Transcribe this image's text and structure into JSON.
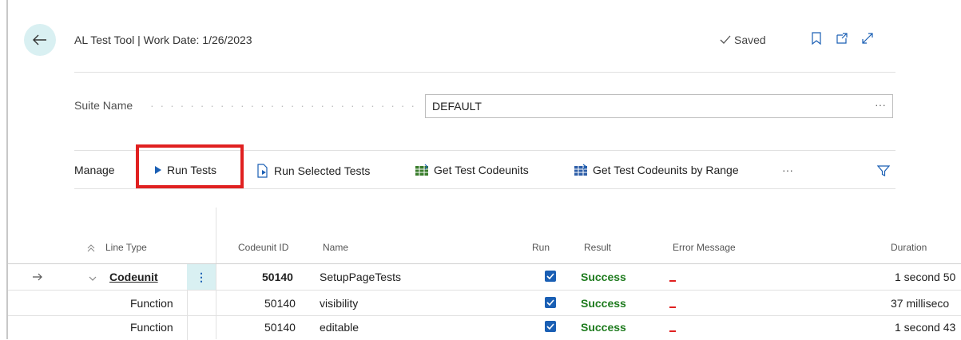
{
  "header": {
    "title": "AL Test Tool | Work Date: 1/26/2023",
    "saved_label": "Saved",
    "icons": [
      "bookmark-icon",
      "open-new-window-icon",
      "expand-icon"
    ]
  },
  "suite": {
    "label": "Suite Name",
    "value": "DEFAULT",
    "ellipsis": "···"
  },
  "actions": {
    "manage": "Manage",
    "run_tests": "Run Tests",
    "run_selected": "Run Selected Tests",
    "get_codeunits": "Get Test Codeunits",
    "get_by_range": "Get Test Codeunits by Range",
    "more": "···"
  },
  "table": {
    "columns": {
      "line_type": "Line Type",
      "codeunit_id": "Codeunit ID",
      "name": "Name",
      "run": "Run",
      "result": "Result",
      "error": "Error Message",
      "duration": "Duration"
    },
    "rows": [
      {
        "line_type": "Codeunit",
        "codeunit_id": "50140",
        "name": "SetupPageTests",
        "run": true,
        "result": "Success",
        "duration": "1 second 50"
      },
      {
        "line_type": "Function",
        "codeunit_id": "50140",
        "name": "visibility",
        "run": true,
        "result": "Success",
        "duration": "37 millisecо"
      },
      {
        "line_type": "Function",
        "codeunit_id": "50140",
        "name": "editable",
        "run": true,
        "result": "Success",
        "duration": "1 second 43"
      }
    ]
  },
  "colors": {
    "accent": "#1a5fb4",
    "success": "#1e7b1e",
    "highlight_box": "#e02020",
    "back_button_bg": "#d9f0f2"
  }
}
